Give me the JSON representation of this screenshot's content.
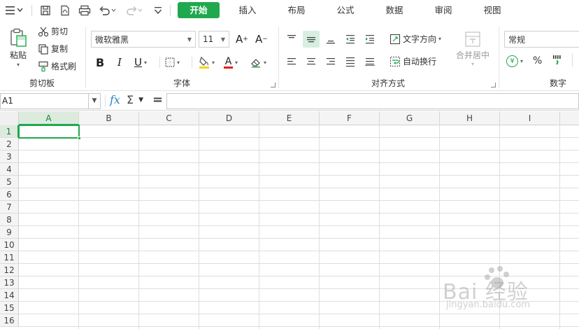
{
  "menubar": {
    "tabs": [
      {
        "label": "开始",
        "active": true
      },
      {
        "label": "插入",
        "active": false
      },
      {
        "label": "布局",
        "active": false
      },
      {
        "label": "公式",
        "active": false
      },
      {
        "label": "数据",
        "active": false
      },
      {
        "label": "审阅",
        "active": false
      },
      {
        "label": "视图",
        "active": false
      }
    ],
    "accent_color": "#1fa84e"
  },
  "ribbon": {
    "clipboard": {
      "paste_label": "粘贴",
      "cut_label": "剪切",
      "copy_label": "复制",
      "format_painter_label": "格式刷",
      "group_label": "剪切板"
    },
    "font": {
      "font_name": "微软雅黑",
      "font_size": "11",
      "bold": "B",
      "italic": "I",
      "underline": "U",
      "increase_size": "A",
      "decrease_size": "A",
      "font_color_letter": "A",
      "group_label": "字体"
    },
    "alignment": {
      "text_direction_label": "文字方向",
      "wrap_text_label": "自动换行",
      "merge_center_label": "合并居中",
      "group_label": "对齐方式"
    },
    "number": {
      "format_value": "常规",
      "currency_symbol": "¥",
      "percent_symbol": "%",
      "group_label": "数字"
    }
  },
  "formula_bar": {
    "name_box_value": "A1",
    "fx_label": "fx",
    "sum_symbol": "Σ",
    "equals_symbol": "=",
    "formula_value": ""
  },
  "sheet": {
    "columns": [
      "A",
      "B",
      "C",
      "D",
      "E",
      "F",
      "G",
      "H",
      "I"
    ],
    "rows": [
      "1",
      "2",
      "3",
      "4",
      "5",
      "6",
      "7",
      "8",
      "9",
      "10",
      "11",
      "12",
      "13",
      "14",
      "15",
      "16"
    ],
    "active_cell": "A1",
    "active_column": "A",
    "active_row": "1"
  },
  "watermark": {
    "main": "Bai 经验",
    "sub": "jingyan.baidu.com"
  }
}
